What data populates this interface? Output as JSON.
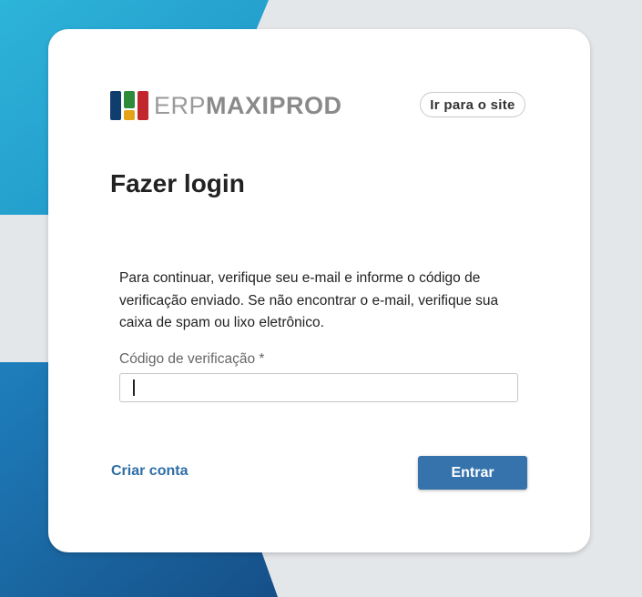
{
  "brand": {
    "name_light": "ERP",
    "name_bold": "MAXIPROD",
    "logo_colors": [
      "#0f3d6e",
      "#2e8b3a",
      "#e5a417",
      "#c1272d"
    ],
    "background_colors": [
      "#2aaed6",
      "#1a5f96",
      "#e4e7ea"
    ]
  },
  "header": {
    "site_button_label": "Ir para o site"
  },
  "login": {
    "title": "Fazer login",
    "description": "Para continuar, verifique seu e-mail e informe o código de verificação enviado. Se não encontrar o e-mail, verifique sua caixa de spam ou lixo eletrônico.",
    "code_label": "Código de verificação *",
    "code_value": "",
    "code_placeholder": ""
  },
  "footer": {
    "create_account_label": "Criar conta",
    "submit_label": "Entrar"
  },
  "colors": {
    "primary": "#3673ad",
    "link": "#2f6ea6"
  }
}
